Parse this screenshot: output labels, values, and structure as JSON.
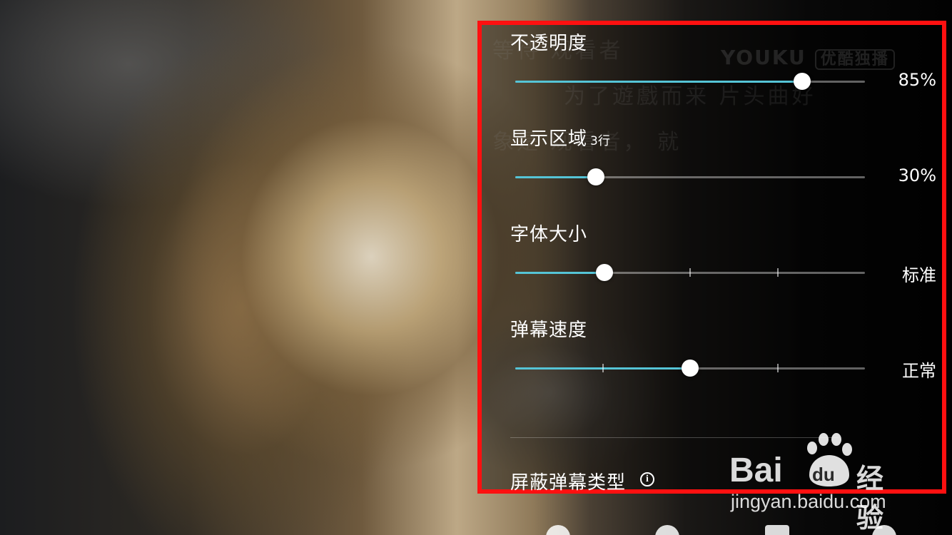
{
  "background": {
    "subtitle_lines": [
      "等待 观看者",
      "为了遊戲而来 片头曲好",
      "象是 观看者， 就"
    ],
    "watermark": {
      "logo_text": "YOUKU",
      "tag_text": "优酷独播"
    }
  },
  "settings": {
    "opacity": {
      "label": "不透明度",
      "value_text": "85%",
      "level": 0.82
    },
    "display_area": {
      "label": "显示区域",
      "sub_label": "3行",
      "value_text": "30%",
      "level": 0.23
    },
    "font_size": {
      "label": "字体大小",
      "value_text": "标准",
      "level": 0.255,
      "steps": 5
    },
    "speed": {
      "label": "弹幕速度",
      "value_text": "正常",
      "level": 0.5,
      "steps": 5
    },
    "block_types": {
      "label": "屏蔽弹幕类型"
    }
  },
  "colors": {
    "accent": "#55c4d6",
    "highlight_border": "#ff1010"
  },
  "baidu_watermark": {
    "brand_bai": "Bai",
    "brand_du": "du",
    "brand_suffix": "经验",
    "url": "jingyan.baidu.com"
  }
}
